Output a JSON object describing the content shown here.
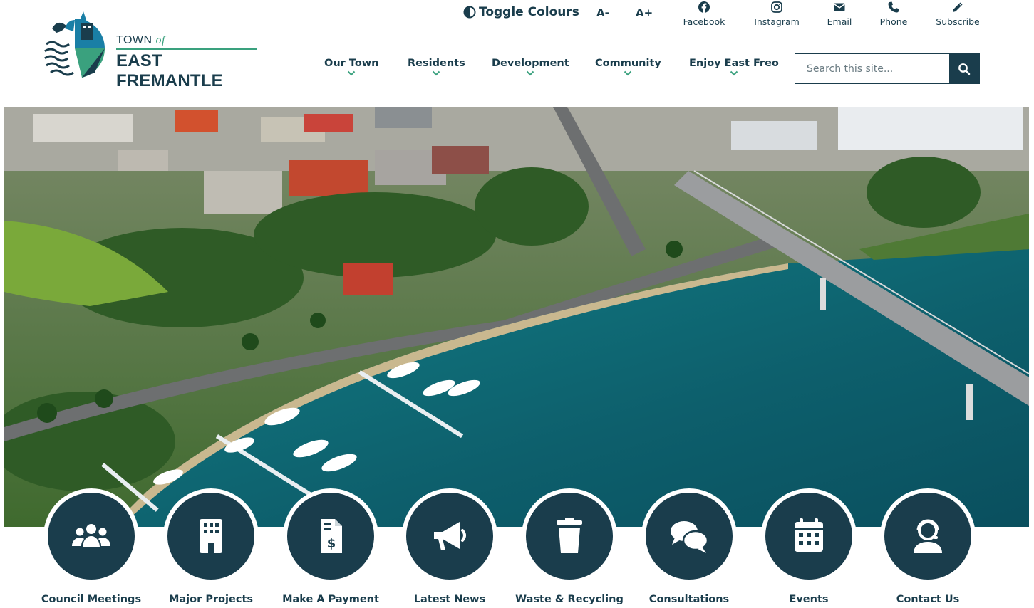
{
  "logo": {
    "line1": "TOWN",
    "line1_of": "of",
    "line2": "EAST FREMANTLE"
  },
  "utility": {
    "toggle_label": "Toggle Colours",
    "font_decrease": "A-",
    "font_increase": "A+",
    "social": [
      {
        "label": "Facebook",
        "icon": "facebook-icon"
      },
      {
        "label": "Instagram",
        "icon": "instagram-icon"
      },
      {
        "label": "Email",
        "icon": "email-icon"
      },
      {
        "label": "Phone",
        "icon": "phone-icon"
      },
      {
        "label": "Subscribe",
        "icon": "pencil-icon"
      }
    ]
  },
  "nav": {
    "items": [
      {
        "label": "Our Town"
      },
      {
        "label": "Residents"
      },
      {
        "label": "Development"
      },
      {
        "label": "Community"
      },
      {
        "label": "Enjoy East Freo"
      }
    ]
  },
  "search": {
    "placeholder": "Search this site..."
  },
  "quick_links": [
    {
      "label": "Council Meetings",
      "icon": "people-group-icon"
    },
    {
      "label": "Major Projects",
      "icon": "building-icon"
    },
    {
      "label": "Make A Payment",
      "icon": "invoice-dollar-icon"
    },
    {
      "label": "Latest News",
      "icon": "megaphone-icon"
    },
    {
      "label": "Waste & Recycling",
      "icon": "trash-can-icon"
    },
    {
      "label": "Consultations",
      "icon": "chat-bubbles-icon"
    },
    {
      "label": "Events",
      "icon": "calendar-icon"
    },
    {
      "label": "Contact Us",
      "icon": "headset-icon"
    }
  ],
  "colors": {
    "primary": "#1a3d4c",
    "accent": "#3aa17e",
    "water": "#0f6d72"
  }
}
